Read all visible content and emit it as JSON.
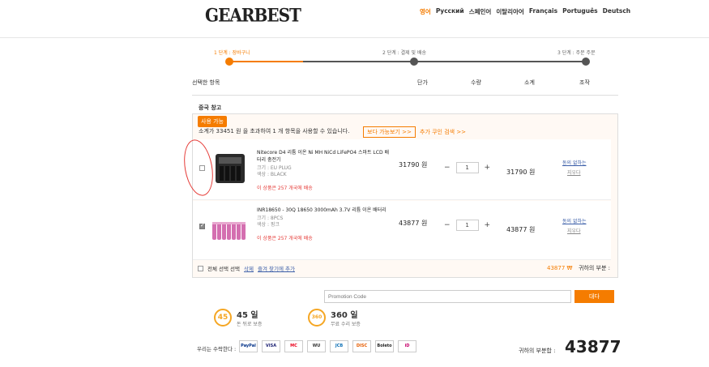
{
  "header": {
    "logo": "GEARBEST",
    "languages": [
      "영어",
      "Русский",
      "스페인어",
      "이탈리아어",
      "Français",
      "Português",
      "Deutsch"
    ]
  },
  "steps": [
    "1 단계 : 장바구니",
    "2 단계 : 결제 및 배송",
    "3 단계 : 주문 주문"
  ],
  "columns": {
    "item": "선택한 항목",
    "unit_price": "단가",
    "quantity": "수량",
    "subtotal": "소계",
    "action": "조작"
  },
  "warehouse": "중국 창고",
  "promo": {
    "tag": "사용 가능",
    "text": "소계가 33451 원 을 초과하여 1 개 항목을 사용할 수 있습니다.",
    "more_button": "보다 가능보기 >>",
    "more_link": "추가 쿠인 검색 >>"
  },
  "items": [
    {
      "name": "Nitecore D4 리튬 이온 Ni MH NiCd LiFePO4 스마트 LCD 배터리 충전기",
      "size": "크기 : EU PLUG",
      "color": "색상 : BLACK",
      "shipping": "이 상품은 257 개국에 배송",
      "unit_price": "31790 원",
      "quantity": "1",
      "subtotal": "31790 원",
      "action1": "동의 없하는",
      "action2": "지우다",
      "checked": false
    },
    {
      "name": "INR18650 - 30Q 18650 3000mAh 3.7V 리튬 이온 배터리",
      "size": "크기 : 8PCS",
      "color": "색상 : 핑크",
      "shipping": "이 상품은 257 개국에 배송",
      "unit_price": "43877 원",
      "quantity": "1",
      "subtotal": "43877 원",
      "action1": "동의 없하는",
      "action2": "지우다",
      "checked": true
    }
  ],
  "footer_row": {
    "select_all": "전체 선택 선택",
    "delete": "삭제",
    "add_fav": "즐겨 찾기에 추가",
    "total": "43877 ₩",
    "subtotal_label": "귀하의 부분 :"
  },
  "promo_code": {
    "placeholder": "Promotion Code",
    "button": "대다"
  },
  "guarantees": [
    {
      "icon": "45",
      "title": "45 일",
      "desc": "돈 뒤로 보증"
    },
    {
      "icon": "360",
      "title": "360 일",
      "desc": "무료 수리 보증"
    }
  ],
  "payment": {
    "label": "우리는 수락한다 :",
    "methods": [
      "PayPal",
      "VISA",
      "MC",
      "WU",
      "JCB",
      "DISC",
      "Boleto",
      "iD"
    ]
  },
  "grand": {
    "label": "귀하의 부분합 :",
    "value": "43877"
  }
}
